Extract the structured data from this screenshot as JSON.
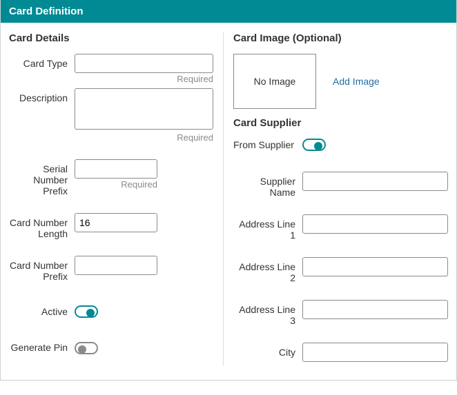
{
  "header": {
    "title": "Card Definition"
  },
  "left": {
    "section_title": "Card Details",
    "card_type": {
      "label": "Card Type",
      "value": "",
      "required": "Required"
    },
    "description": {
      "label": "Description",
      "value": "",
      "required": "Required"
    },
    "serial_prefix": {
      "label": "Serial Number Prefix",
      "value": "",
      "required": "Required"
    },
    "card_number_length": {
      "label": "Card Number Length",
      "value": "16"
    },
    "card_number_prefix": {
      "label": "Card Number Prefix",
      "value": ""
    },
    "active": {
      "label": "Active",
      "value": true
    },
    "generate_pin": {
      "label": "Generate Pin",
      "value": false
    }
  },
  "right": {
    "image_section_title": "Card Image (Optional)",
    "no_image_text": "No Image",
    "add_image_label": "Add Image",
    "supplier_section_title": "Card Supplier",
    "from_supplier": {
      "label": "From Supplier",
      "value": true
    },
    "supplier_name": {
      "label": "Supplier Name",
      "value": ""
    },
    "address1": {
      "label": "Address Line 1",
      "value": ""
    },
    "address2": {
      "label": "Address Line 2",
      "value": ""
    },
    "address3": {
      "label": "Address Line 3",
      "value": ""
    },
    "city": {
      "label": "City",
      "value": ""
    }
  }
}
